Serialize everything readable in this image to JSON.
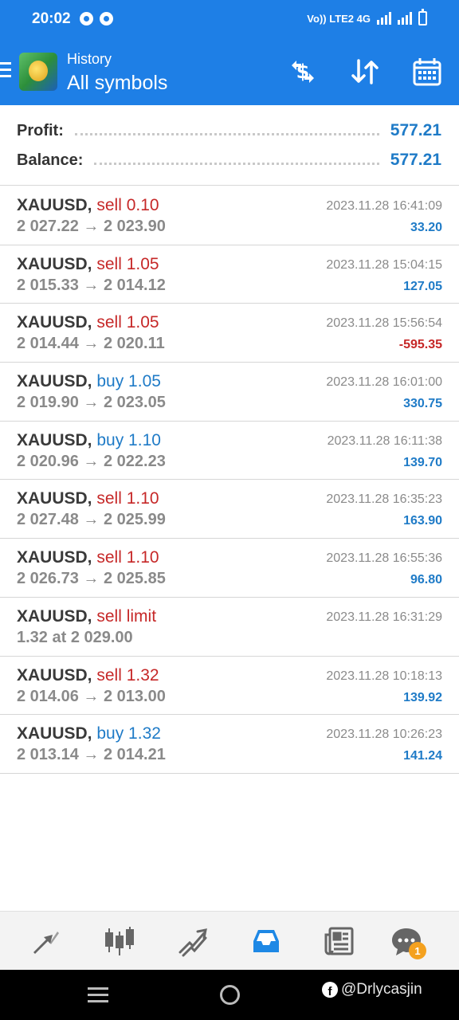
{
  "status": {
    "time": "20:02",
    "network_label": "Vo)) LTE2 4G"
  },
  "header": {
    "subtitle": "History",
    "title": "All symbols",
    "actions": [
      "currency-exchange-icon",
      "sort-icon",
      "calendar-icon"
    ]
  },
  "summary": {
    "profit_label": "Profit:",
    "profit_value": "577.21",
    "balance_label": "Balance:",
    "balance_value": "577.21"
  },
  "deals": [
    {
      "symbol": "XAUUSD,",
      "side": "sell 0.10",
      "direction": "sell",
      "prices": "2 027.22 → 2 023.90",
      "time": "2023.11.28 16:41:09",
      "pl": "33.20"
    },
    {
      "symbol": "XAUUSD,",
      "side": "sell 1.05",
      "direction": "sell",
      "prices": "2 015.33 → 2 014.12",
      "time": "2023.11.28 15:04:15",
      "pl": "127.05"
    },
    {
      "symbol": "XAUUSD,",
      "side": "sell 1.05",
      "direction": "sell",
      "prices": "2 014.44 → 2 020.11",
      "time": "2023.11.28 15:56:54",
      "pl": "-595.35"
    },
    {
      "symbol": "XAUUSD,",
      "side": "buy 1.05",
      "direction": "buy",
      "prices": "2 019.90 → 2 023.05",
      "time": "2023.11.28 16:01:00",
      "pl": "330.75"
    },
    {
      "symbol": "XAUUSD,",
      "side": "buy 1.10",
      "direction": "buy",
      "prices": "2 020.96 → 2 022.23",
      "time": "2023.11.28 16:11:38",
      "pl": "139.70"
    },
    {
      "symbol": "XAUUSD,",
      "side": "sell 1.10",
      "direction": "sell",
      "prices": "2 027.48 → 2 025.99",
      "time": "2023.11.28 16:35:23",
      "pl": "163.90"
    },
    {
      "symbol": "XAUUSD,",
      "side": "sell 1.10",
      "direction": "sell",
      "prices": "2 026.73 → 2 025.85",
      "time": "2023.11.28 16:55:36",
      "pl": "96.80"
    },
    {
      "symbol": "XAUUSD,",
      "side": "sell limit",
      "direction": "sell",
      "prices": "1.32 at 2 029.00",
      "time": "2023.11.28 16:31:29",
      "pl": ""
    },
    {
      "symbol": "XAUUSD,",
      "side": "sell 1.32",
      "direction": "sell",
      "prices": "2 014.06 → 2 013.00",
      "time": "2023.11.28 10:18:13",
      "pl": "139.92"
    },
    {
      "symbol": "XAUUSD,",
      "side": "buy 1.32",
      "direction": "buy",
      "prices": "2 013.14 → 2 014.21",
      "time": "2023.11.28 10:26:23",
      "pl": "141.24"
    }
  ],
  "bottom_nav": {
    "items": [
      "quotes-icon",
      "chart-icon",
      "trade-icon",
      "history-icon",
      "news-icon",
      "chat-icon"
    ],
    "active": "history-icon",
    "chat_badge": "1"
  },
  "watermark": "@Drlycasjin",
  "colors": {
    "accent": "#1e7fe6",
    "sell": "#c62828",
    "buy": "#1f7bc7"
  }
}
